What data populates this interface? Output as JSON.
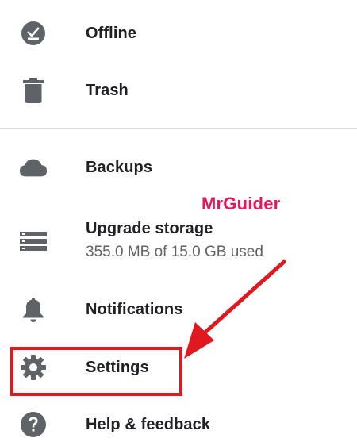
{
  "menu": {
    "offline": {
      "label": "Offline",
      "icon": "offline-check-icon"
    },
    "trash": {
      "label": "Trash",
      "icon": "trash-icon"
    },
    "backups": {
      "label": "Backups",
      "icon": "cloud-icon"
    },
    "upgrade_storage": {
      "label": "Upgrade storage",
      "usage": "355.0 MB of 15.0 GB used",
      "icon": "storage-icon"
    },
    "notifications": {
      "label": "Notifications",
      "icon": "bell-icon"
    },
    "settings": {
      "label": "Settings",
      "icon": "gear-icon"
    },
    "help": {
      "label": "Help & feedback",
      "icon": "help-icon"
    }
  },
  "annotation": {
    "watermark": "MrGuider",
    "highlight_color": "#e0181f",
    "watermark_color": "#e8175d"
  },
  "colors": {
    "icon": "#5f6368",
    "text": "#202124",
    "subtext": "#5f6368",
    "divider": "#dadce0"
  }
}
